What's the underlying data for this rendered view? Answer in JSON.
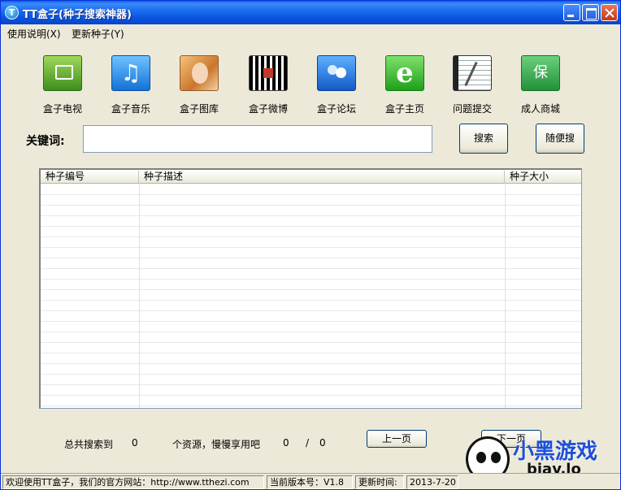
{
  "window": {
    "title": "TT盒子(种子搜索神器)",
    "icon_text": "T"
  },
  "menu": {
    "items": [
      {
        "label": "使用说明(X)"
      },
      {
        "label": "更新种子(Y)"
      }
    ]
  },
  "toolbar": {
    "items": [
      {
        "label": "盒子电视",
        "icon": "tv-icon"
      },
      {
        "label": "盒子音乐",
        "icon": "music-note-icon"
      },
      {
        "label": "盒子图库",
        "icon": "photo-icon"
      },
      {
        "label": "盒子微博",
        "icon": "qr-code-icon"
      },
      {
        "label": "盒子论坛",
        "icon": "forum-users-icon"
      },
      {
        "label": "盒子主页",
        "icon": "ie-browser-icon"
      },
      {
        "label": "问题提交",
        "icon": "notebook-icon"
      },
      {
        "label": "成人商城",
        "icon": "shield-shop-icon"
      }
    ],
    "music_glyph": "♫",
    "home_glyph": "e",
    "shop_glyph": "保"
  },
  "search": {
    "label": "关键词:",
    "value": "",
    "search_button": "搜索",
    "random_button": "随便搜"
  },
  "results": {
    "columns": [
      "种子编号",
      "种子描述",
      "种子大小"
    ],
    "rows": []
  },
  "pager": {
    "total_prefix": "总共搜索到",
    "total_count": "0",
    "total_suffix": "个资源，慢慢享用吧",
    "current_page": "0",
    "separator": "/",
    "total_pages": "0",
    "prev_button": "上一页",
    "next_button": "下一页"
  },
  "statusbar": {
    "welcome": "欢迎使用TT盒子，我们的官方网站：http://www.tthezi.com",
    "version": "当前版本号：V1.8",
    "update_label": "更新时间:",
    "update_date": "2013-7-20"
  },
  "watermark": {
    "text": "小黑游戏",
    "sub": "biav.lo"
  },
  "colors": {
    "titlebar": "#0a56e3",
    "window_bg": "#ece9d8",
    "list_border": "#7f9db9"
  }
}
